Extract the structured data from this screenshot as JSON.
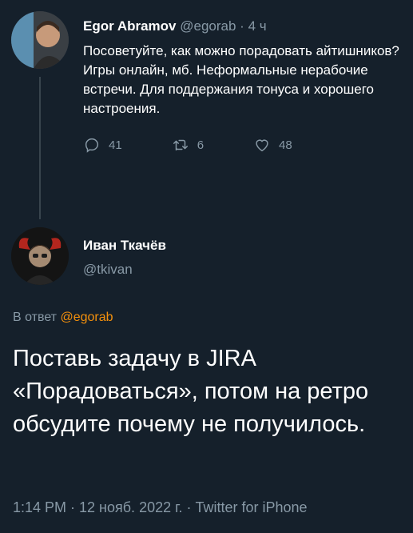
{
  "tweet1": {
    "author_name": "Egor Abramov",
    "handle": "@egorab",
    "separator": " · ",
    "time": "4 ч",
    "text": "Посоветуйте, как можно порадовать айтишников? Игры онлайн, мб. Неформальные нерабочие встречи. Для поддержания тонуса и хорошего настроения.",
    "actions": {
      "reply_icon": "reply-icon",
      "reply_count": "41",
      "retweet_icon": "retweet-icon",
      "retweet_count": "6",
      "like_icon": "heart-icon",
      "like_count": "48"
    }
  },
  "tweet2": {
    "author_name": "Иван Ткачёв",
    "handle": "@tkivan",
    "reply_prefix": "В ответ",
    "reply_mention": "@egorab",
    "text": "Поставь задачу в JIRA «Порадоваться», потом на ретро обсудите почему не получилось.",
    "footer": "1:14 PM · 12 нояб. 2022 г. · Twitter for iPhone"
  },
  "colors": {
    "background": "#15202b",
    "text": "#ffffff",
    "secondary": "#8899a6",
    "mention": "#f4900c"
  }
}
